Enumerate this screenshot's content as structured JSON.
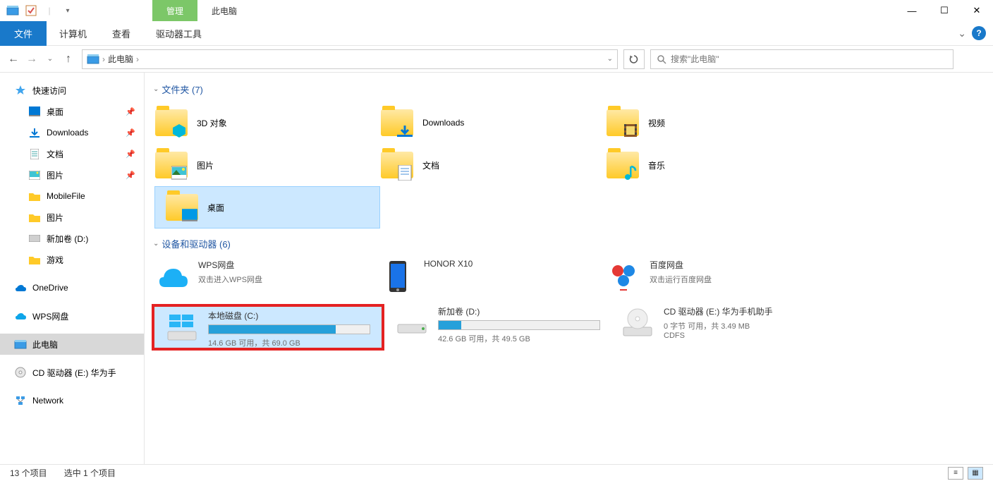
{
  "titlebar": {
    "manage": "管理",
    "title": "此电脑"
  },
  "ribbon": {
    "file": "文件",
    "computer": "计算机",
    "view": "查看",
    "drive_tools": "驱动器工具"
  },
  "address": {
    "location": "此电脑",
    "separator": "›"
  },
  "search": {
    "placeholder": "搜索\"此电脑\""
  },
  "sidebar": {
    "quick_access": "快速访问",
    "desktop": "桌面",
    "downloads": "Downloads",
    "documents": "文档",
    "pictures": "图片",
    "mobilefile": "MobileFile",
    "pictures2": "图片",
    "newvol": "新加卷 (D:)",
    "games": "游戏",
    "onedrive": "OneDrive",
    "wps": "WPS网盘",
    "thispc": "此电脑",
    "cd_drive": "CD 驱动器 (E:) 华为手",
    "network": "Network"
  },
  "groups": {
    "folders": "文件夹 (7)",
    "devices": "设备和驱动器 (6)"
  },
  "folders": [
    {
      "label": "3D 对象"
    },
    {
      "label": "Downloads"
    },
    {
      "label": "视频"
    },
    {
      "label": "图片"
    },
    {
      "label": "文档"
    },
    {
      "label": "音乐"
    },
    {
      "label": "桌面"
    }
  ],
  "drives": [
    {
      "name": "WPS网盘",
      "sub": "双击进入WPS网盘"
    },
    {
      "name": "HONOR X10",
      "sub": ""
    },
    {
      "name": "百度网盘",
      "sub": "双击运行百度网盘"
    },
    {
      "name": "本地磁盘 (C:)",
      "sub": "14.6 GB 可用，共 69.0 GB",
      "fill": 79
    },
    {
      "name": "新加卷 (D:)",
      "sub": "42.6 GB 可用，共 49.5 GB",
      "fill": 14
    },
    {
      "name": "CD 驱动器 (E:) 华为手机助手",
      "sub": "0 字节 可用，共 3.49 MB",
      "sub2": "CDFS"
    }
  ],
  "statusbar": {
    "items": "13 个项目",
    "selected": "选中 1 个项目"
  }
}
